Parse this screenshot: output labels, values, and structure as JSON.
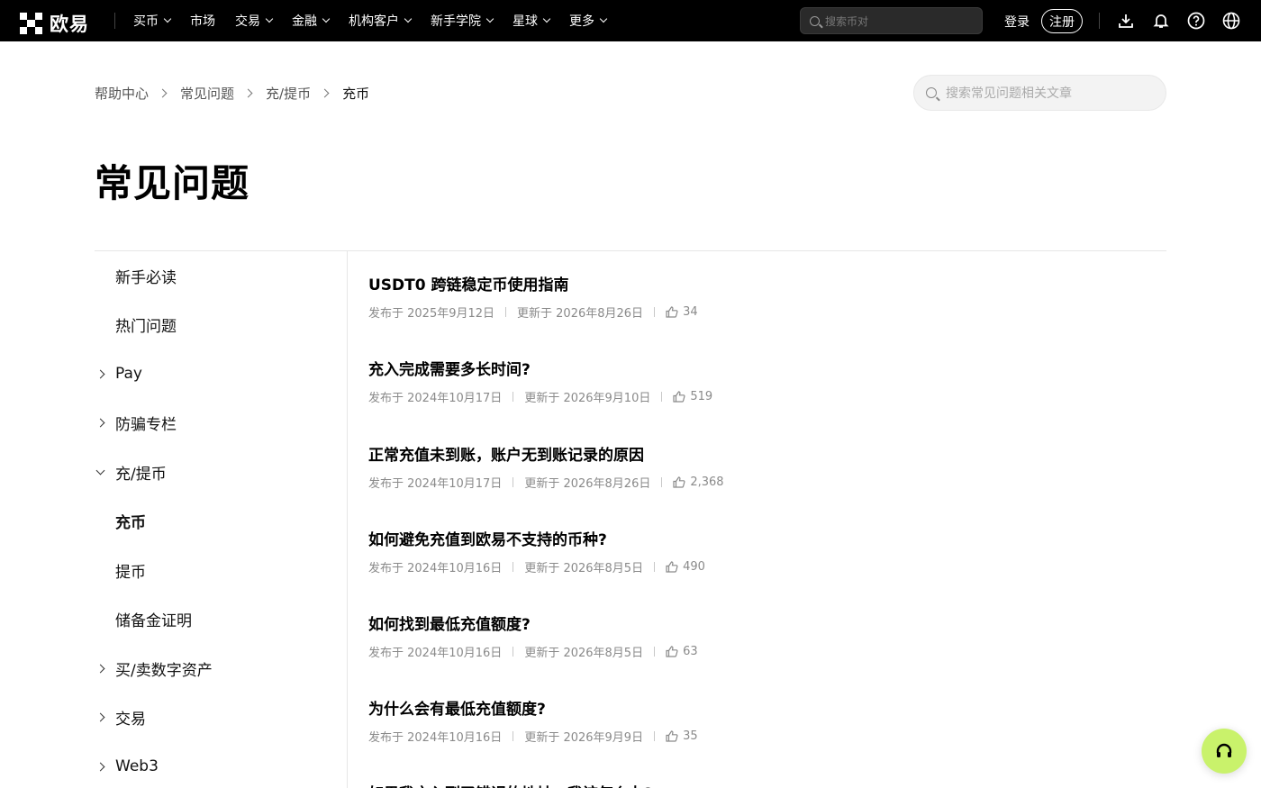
{
  "brand": {
    "name": "欧易"
  },
  "nav": {
    "items": [
      {
        "label": "买币",
        "dropdown": true
      },
      {
        "label": "市场",
        "dropdown": false
      },
      {
        "label": "交易",
        "dropdown": true
      },
      {
        "label": "金融",
        "dropdown": true
      },
      {
        "label": "机构客户",
        "dropdown": true
      },
      {
        "label": "新手学院",
        "dropdown": true
      },
      {
        "label": "星球",
        "dropdown": true
      },
      {
        "label": "更多",
        "dropdown": true
      }
    ],
    "search_placeholder": "搜索币对",
    "login_label": "登录",
    "register_label": "注册",
    "icons": [
      "download-icon",
      "bell-icon",
      "help-icon",
      "globe-icon"
    ]
  },
  "breadcrumb": [
    "帮助中心",
    "常见问题",
    "充/提币",
    "充币"
  ],
  "help_search": {
    "placeholder": "搜索常见问题相关文章"
  },
  "page_title": "常见问题",
  "sidebar": {
    "items": [
      {
        "label": "新手必读",
        "chevron": "none",
        "active": false
      },
      {
        "label": "热门问题",
        "chevron": "none",
        "active": false
      },
      {
        "label": "Pay",
        "chevron": "right",
        "active": false
      },
      {
        "label": "防骗专栏",
        "chevron": "right",
        "active": false
      },
      {
        "label": "充/提币",
        "chevron": "down",
        "active": false
      },
      {
        "label": "充币",
        "chevron": "none",
        "active": true
      },
      {
        "label": "提币",
        "chevron": "none",
        "active": false
      },
      {
        "label": "储备金证明",
        "chevron": "none",
        "active": false
      },
      {
        "label": "买/卖数字资产",
        "chevron": "right",
        "active": false
      },
      {
        "label": "交易",
        "chevron": "right",
        "active": false
      },
      {
        "label": "Web3",
        "chevron": "right",
        "active": false
      }
    ]
  },
  "articles": [
    {
      "title": "USDT0 跨链稳定币使用指南",
      "published": "发布于 2025年9月12日",
      "updated": "更新于 2026年8月26日",
      "likes": "34"
    },
    {
      "title": "充入完成需要多长时间?",
      "published": "发布于 2024年10月17日",
      "updated": "更新于 2026年9月10日",
      "likes": "519"
    },
    {
      "title": "正常充值未到账，账户无到账记录的原因",
      "published": "发布于 2024年10月17日",
      "updated": "更新于 2026年8月26日",
      "likes": "2,368"
    },
    {
      "title": "如何避免充值到欧易不支持的币种?",
      "published": "发布于 2024年10月16日",
      "updated": "更新于 2026年8月5日",
      "likes": "490"
    },
    {
      "title": "如何找到最低充值额度?",
      "published": "发布于 2024年10月16日",
      "updated": "更新于 2026年8月5日",
      "likes": "63"
    },
    {
      "title": "为什么会有最低充值额度?",
      "published": "发布于 2024年10月16日",
      "updated": "更新于 2026年9月9日",
      "likes": "35"
    },
    {
      "title": "如果我充入到了错误的地址，我该怎么办?",
      "published": "",
      "updated": "",
      "likes": ""
    }
  ],
  "colors": {
    "topbar": "#000000",
    "accent_fab": "#c9f26b"
  }
}
